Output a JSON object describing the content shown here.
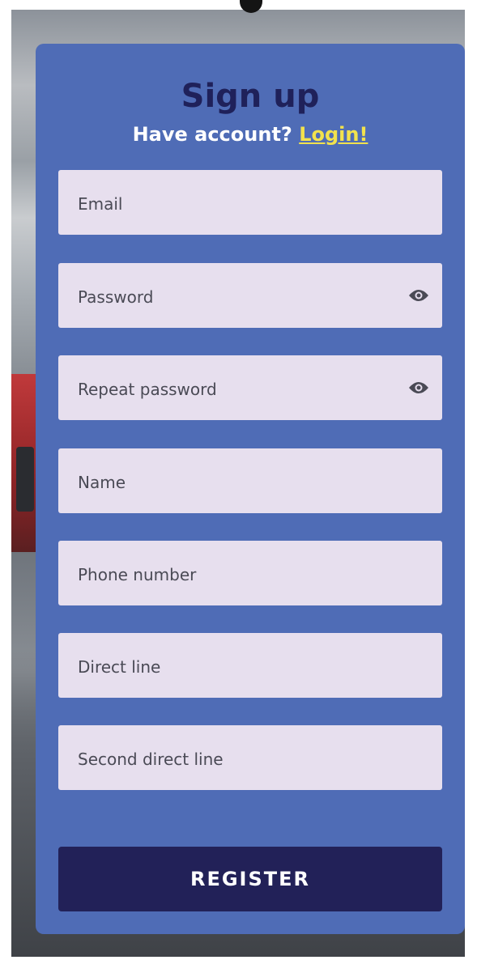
{
  "header": {
    "title": "Sign up",
    "subtitle_prefix": "Have account? ",
    "login_link": "Login!"
  },
  "fields": [
    {
      "placeholder": "Email",
      "icon": null
    },
    {
      "placeholder": "Password",
      "icon": "eye-icon"
    },
    {
      "placeholder": "Repeat password",
      "icon": "eye-icon"
    },
    {
      "placeholder": "Name",
      "icon": null
    },
    {
      "placeholder": "Phone number",
      "icon": null
    },
    {
      "placeholder": "Direct line",
      "icon": null
    },
    {
      "placeholder": "Second direct line",
      "icon": null
    }
  ],
  "actions": {
    "register_label": "REGISTER"
  },
  "colors": {
    "card": "#4f6cb6",
    "title": "#1f215a",
    "field": "#e7dfee",
    "link": "#f2e24d",
    "button": "#222158"
  }
}
